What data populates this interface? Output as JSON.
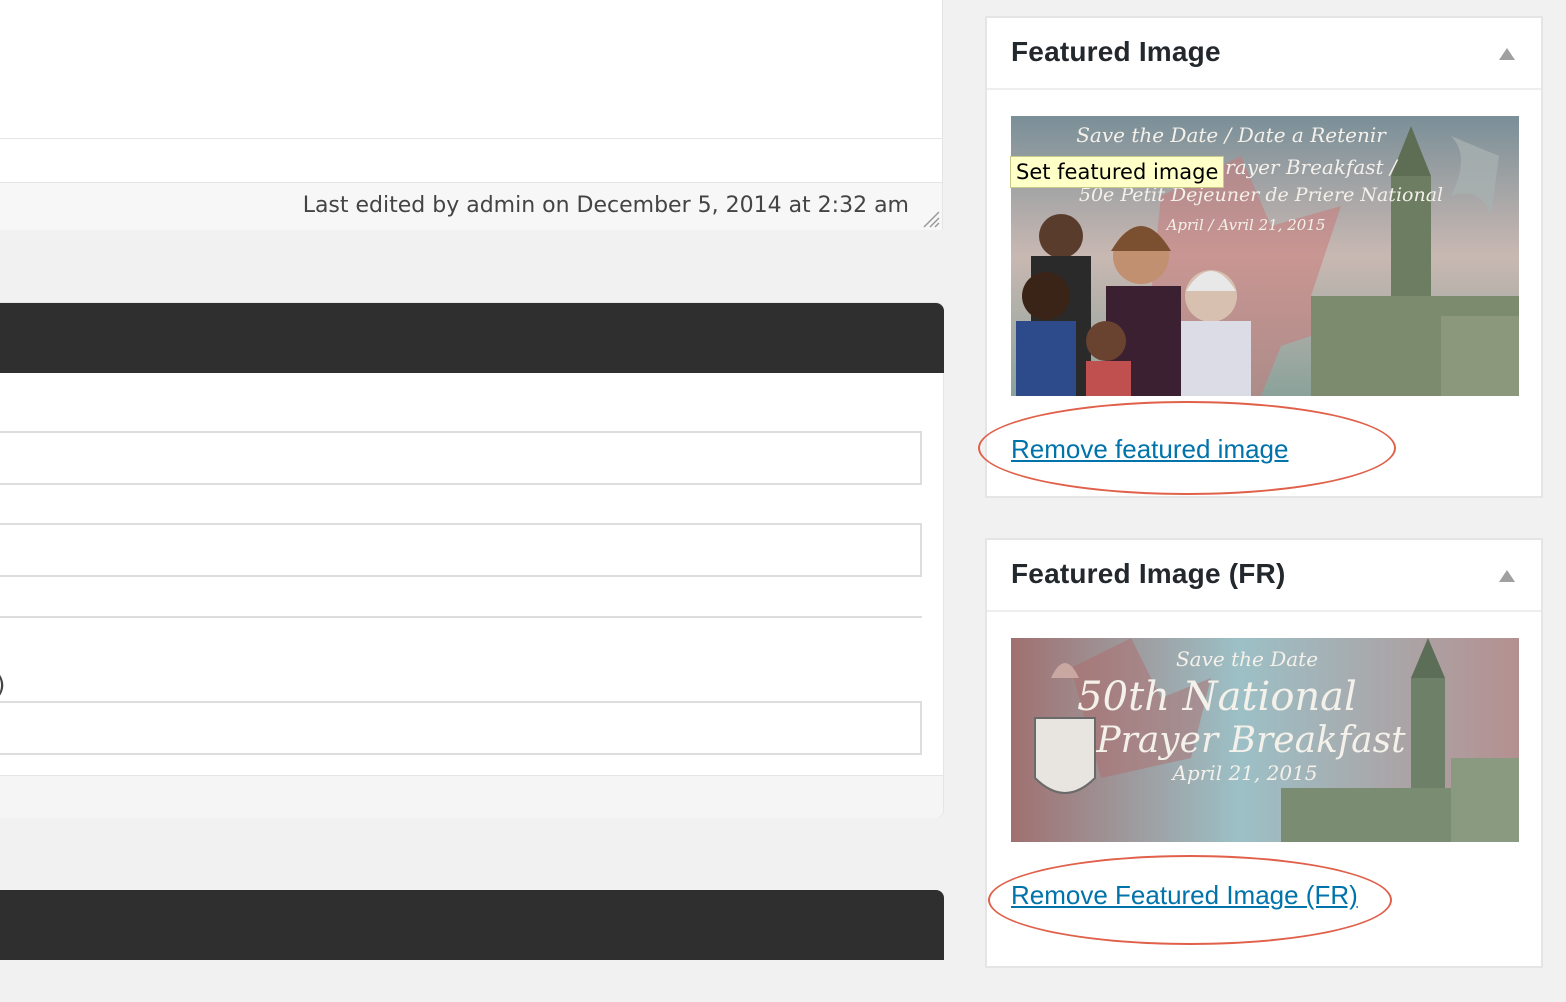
{
  "editor": {
    "status_text": "Last edited by admin on December 5, 2014 at 2:32 am",
    "stray_glyph": ")"
  },
  "sidebar": {
    "featured_image": {
      "title": "Featured Image",
      "image_banner_lines": [
        "Save the Date / Date a Retenir",
        "rayer Breakfast /",
        "50e Petit Dejeuner de Priere National",
        "April / Avril 21, 2015"
      ],
      "remove_link": "Remove featured image",
      "tooltip": "Set featured image"
    },
    "featured_image_fr": {
      "title": "Featured Image (FR)",
      "image_banner_lines": [
        "Save the Date",
        "50th National",
        "Prayer Breakfast",
        "April 21, 2015"
      ],
      "remove_link": "Remove Featured Image (FR)"
    }
  },
  "colors": {
    "link": "#0073aa",
    "annotation": "#e0604a",
    "dark_header": "#2f2f2f"
  }
}
